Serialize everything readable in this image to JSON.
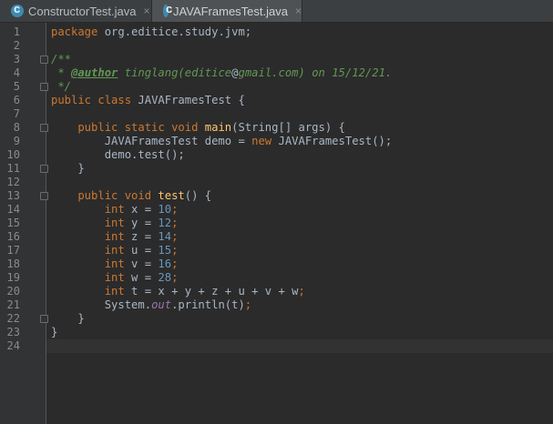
{
  "tabs": [
    {
      "label": "ConstructorTest.java",
      "close": "×",
      "icon": "java-class-icon"
    },
    {
      "label": "JAVAFramesTest.java",
      "close": "×",
      "icon": "java-class-icon"
    }
  ],
  "line_numbers": [
    "1",
    "2",
    "3",
    "4",
    "5",
    "6",
    "7",
    "8",
    "9",
    "10",
    "11",
    "12",
    "13",
    "14",
    "15",
    "16",
    "17",
    "18",
    "19",
    "20",
    "21",
    "22",
    "23",
    "24"
  ],
  "code": {
    "l1": {
      "a": "package",
      "b": " org.editice.study.jvm;"
    },
    "l3": {
      "a": "/**"
    },
    "l4": {
      "a": " * ",
      "b": "@author",
      "c": " tinglang(editice",
      "d": "@",
      "e": "gmail.com) on 15/12/21."
    },
    "l5": {
      "a": " */"
    },
    "l6": {
      "a": "public class",
      "b": " JAVAFramesTest {"
    },
    "l8": {
      "a": "    public static void",
      "b": " main",
      "c": "(String[] args) {"
    },
    "l9": {
      "a": "        JAVAFramesTest demo = ",
      "b": "new",
      "c": " JAVAFramesTest();"
    },
    "l10": {
      "a": "        demo.test();"
    },
    "l11": {
      "a": "    }"
    },
    "l13": {
      "a": "    public void",
      "b": " test",
      "c": "() {"
    },
    "l14": {
      "a": "        int",
      "b": " x = ",
      "c": "10",
      "d": ";"
    },
    "l15": {
      "a": "        int",
      "b": " y = ",
      "c": "12",
      "d": ";"
    },
    "l16": {
      "a": "        int",
      "b": " z = ",
      "c": "14",
      "d": ";"
    },
    "l17": {
      "a": "        int",
      "b": " u = ",
      "c": "15",
      "d": ";"
    },
    "l18": {
      "a": "        int",
      "b": " v = ",
      "c": "16",
      "d": ";"
    },
    "l19": {
      "a": "        int",
      "b": " w = ",
      "c": "28",
      "d": ";"
    },
    "l20": {
      "a": "        int",
      "b": " t = x + y + z + u + v + w",
      "c": ";"
    },
    "l21": {
      "a": "        System.",
      "b": "out",
      "c": ".println(t)",
      "d": ";"
    },
    "l22": {
      "a": "    }"
    },
    "l23": {
      "a": "}"
    }
  }
}
